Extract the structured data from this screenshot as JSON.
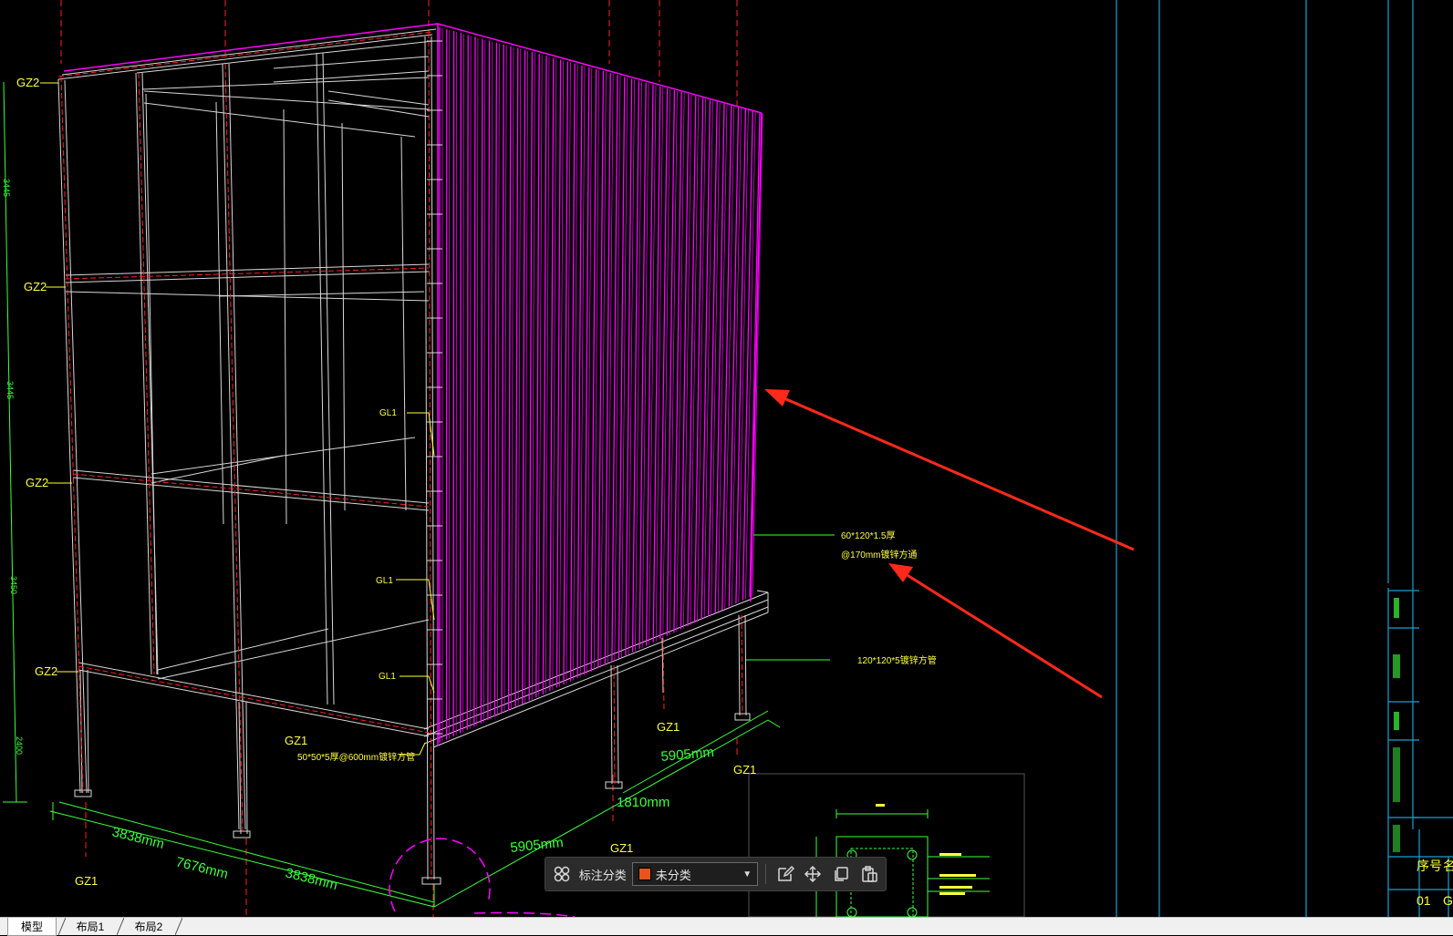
{
  "drawing": {
    "column_labels": {
      "gz2": "GZ2",
      "gz1": "GZ1"
    },
    "beam_labels": {
      "gl1": "GL1"
    },
    "annotations": {
      "panel_spec_line1": "60*120*1.5厚",
      "panel_spec_line2": "@170mm镀锌方通",
      "beam_spec": "120*120*5镀锌方管",
      "bottom_spec": "50*50*5厚@600mm镀锌方管"
    },
    "dimensions": {
      "d_3838_a": "3838mm",
      "d_7676": "7676mm",
      "d_3838_b": "3838mm",
      "d_5905_a": "5905mm",
      "d_5905_b": "5905mm",
      "d_1810": "1810mm",
      "v_3445_a": "3445",
      "v_3445_b": "3445",
      "v_3450": "3450",
      "v_2400": "2400"
    },
    "title_block": {
      "col_header_1": "序号",
      "col_header_2": "名",
      "row_1_value": "01",
      "row_1_name": "G"
    },
    "colors": {
      "magenta": "#ff00ff",
      "red_centerline": "#ff2020",
      "yellow_text": "#ffff3c",
      "green_dim": "#3cff3c",
      "cyan_frame": "#19a0d2",
      "arrow_red": "#ff2a1a"
    }
  },
  "anno_toolbar": {
    "label": "标注分类",
    "selected": "未分类",
    "swatch_color": "#e8541c",
    "icons": [
      "grid-icon",
      "edit-icon",
      "move-icon",
      "copy-icon",
      "paste-icon"
    ]
  },
  "tabs": [
    {
      "label": "模型",
      "active": true
    },
    {
      "label": "布局1",
      "active": false
    },
    {
      "label": "布局2",
      "active": false
    }
  ]
}
